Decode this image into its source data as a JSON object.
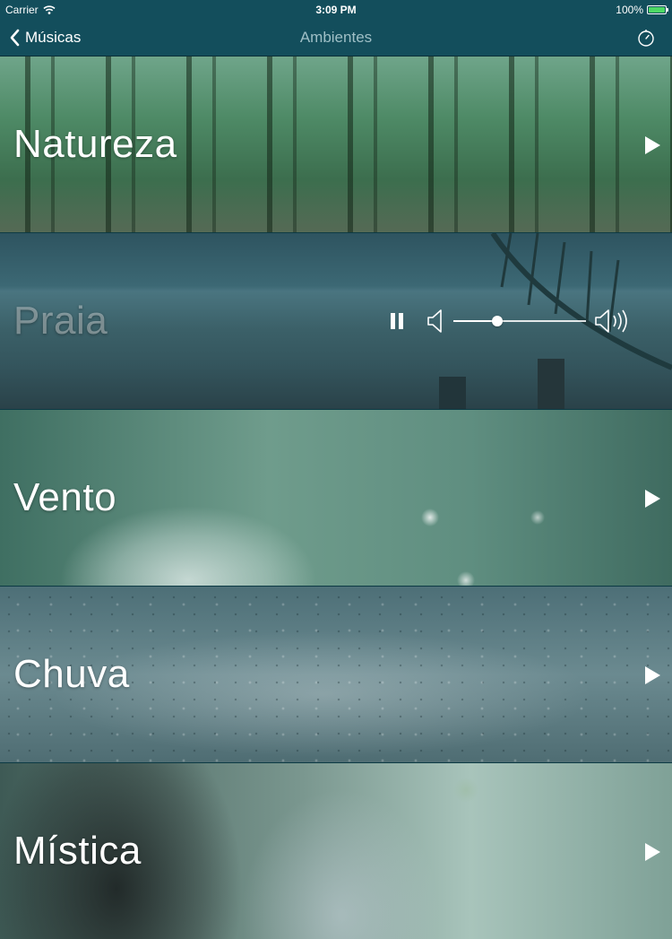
{
  "status": {
    "carrier": "Carrier",
    "time": "3:09 PM",
    "battery": "100%",
    "battery_level": 1.0
  },
  "nav": {
    "back_label": "Músicas",
    "title": "Ambientes"
  },
  "rows": [
    {
      "label": "Natureza",
      "state": "stopped"
    },
    {
      "label": "Praia",
      "state": "playing"
    },
    {
      "label": "Vento",
      "state": "stopped"
    },
    {
      "label": "Chuva",
      "state": "stopped"
    },
    {
      "label": "Mística",
      "state": "stopped"
    }
  ],
  "player": {
    "volume": 0.33
  },
  "colors": {
    "bar": "#134e5c",
    "battery_fill": "#4cd964"
  }
}
